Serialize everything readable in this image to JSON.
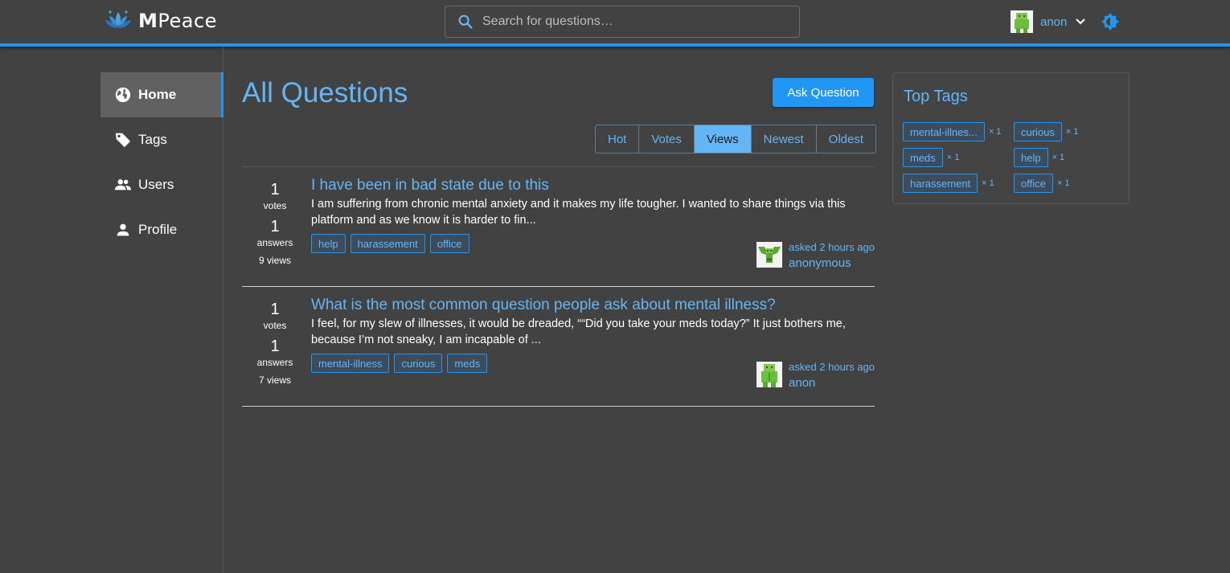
{
  "brand": {
    "name_bold": "M",
    "name_rest": "Peace"
  },
  "search": {
    "placeholder": "Search for questions…"
  },
  "user": {
    "name": "anon"
  },
  "nav": [
    {
      "label": "Home",
      "icon": "globe-icon",
      "active": true
    },
    {
      "label": "Tags",
      "icon": "tag-icon",
      "active": false
    },
    {
      "label": "Users",
      "icon": "users-icon",
      "active": false
    },
    {
      "label": "Profile",
      "icon": "person-icon",
      "active": false
    }
  ],
  "main": {
    "title": "All Questions",
    "ask_button": "Ask Question",
    "sort_options": [
      "Hot",
      "Votes",
      "Views",
      "Newest",
      "Oldest"
    ],
    "active_sort": "Views"
  },
  "questions": [
    {
      "votes": "1",
      "votes_label": "votes",
      "answers": "1",
      "answers_label": "answers",
      "views": "9 views",
      "title": "I have been in bad state due to this",
      "excerpt": "I am suffering from chronic mental anxiety and it makes my life tougher. I wanted to share things via this platform and as we know it is harder to fin...",
      "tags": [
        "help",
        "harassement",
        "office"
      ],
      "asked": "asked 2 hours ago",
      "author": "anonymous"
    },
    {
      "votes": "1",
      "votes_label": "votes",
      "answers": "1",
      "answers_label": "answers",
      "views": "7 views",
      "title": "What is the most common question people ask about mental illness?",
      "excerpt": "I feel, for my slew of illnesses, it would be dreaded, ““Did you take your meds today?” It just bothers me, because I’m not sneaky, I am incapable of ...",
      "tags": [
        "mental-illness",
        "curious",
        "meds"
      ],
      "asked": "asked 2 hours ago",
      "author": "anon"
    }
  ],
  "top_tags": {
    "title": "Top Tags",
    "items": [
      {
        "name": "mental-illnes...",
        "count": "× 1"
      },
      {
        "name": "curious",
        "count": "× 1"
      },
      {
        "name": "meds",
        "count": "× 1"
      },
      {
        "name": "help",
        "count": "× 1"
      },
      {
        "name": "harassement",
        "count": "× 1"
      },
      {
        "name": "office",
        "count": "× 1"
      }
    ]
  },
  "colors": {
    "accent": "#2196f3",
    "link": "#64b5f6",
    "background": "#424242"
  }
}
